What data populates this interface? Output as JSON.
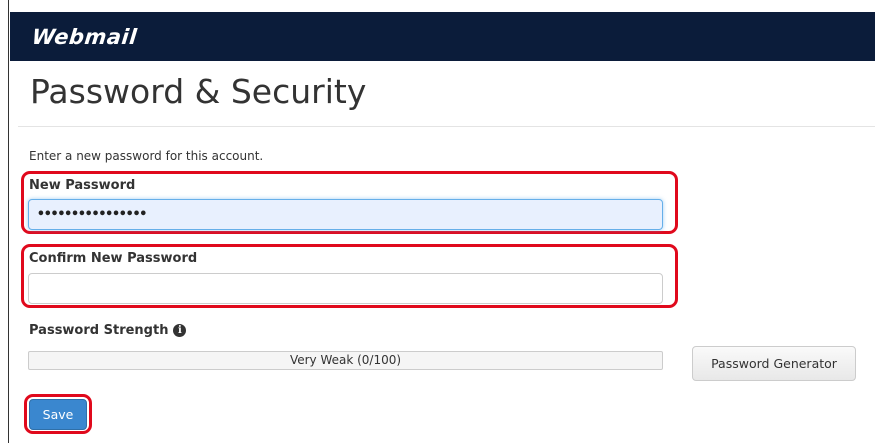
{
  "header": {
    "logo_text": "Webmail"
  },
  "page": {
    "title": "Password & Security",
    "intro": "Enter a new password for this account."
  },
  "form": {
    "new_password": {
      "label": "New Password",
      "value": "••••••••••••••••"
    },
    "confirm_password": {
      "label": "Confirm New Password",
      "value": ""
    },
    "strength": {
      "label": "Password Strength",
      "text": "Very Weak (0/100)",
      "score": 0,
      "max": 100
    },
    "generator_label": "Password Generator",
    "save_label": "Save"
  },
  "colors": {
    "header_bg": "#0b1c3a",
    "highlight": "#e0091c",
    "primary_button": "#3a87cf",
    "focused_input_bg": "#e8f0fe"
  },
  "icons": {
    "strength_info": "info-circle-icon"
  }
}
